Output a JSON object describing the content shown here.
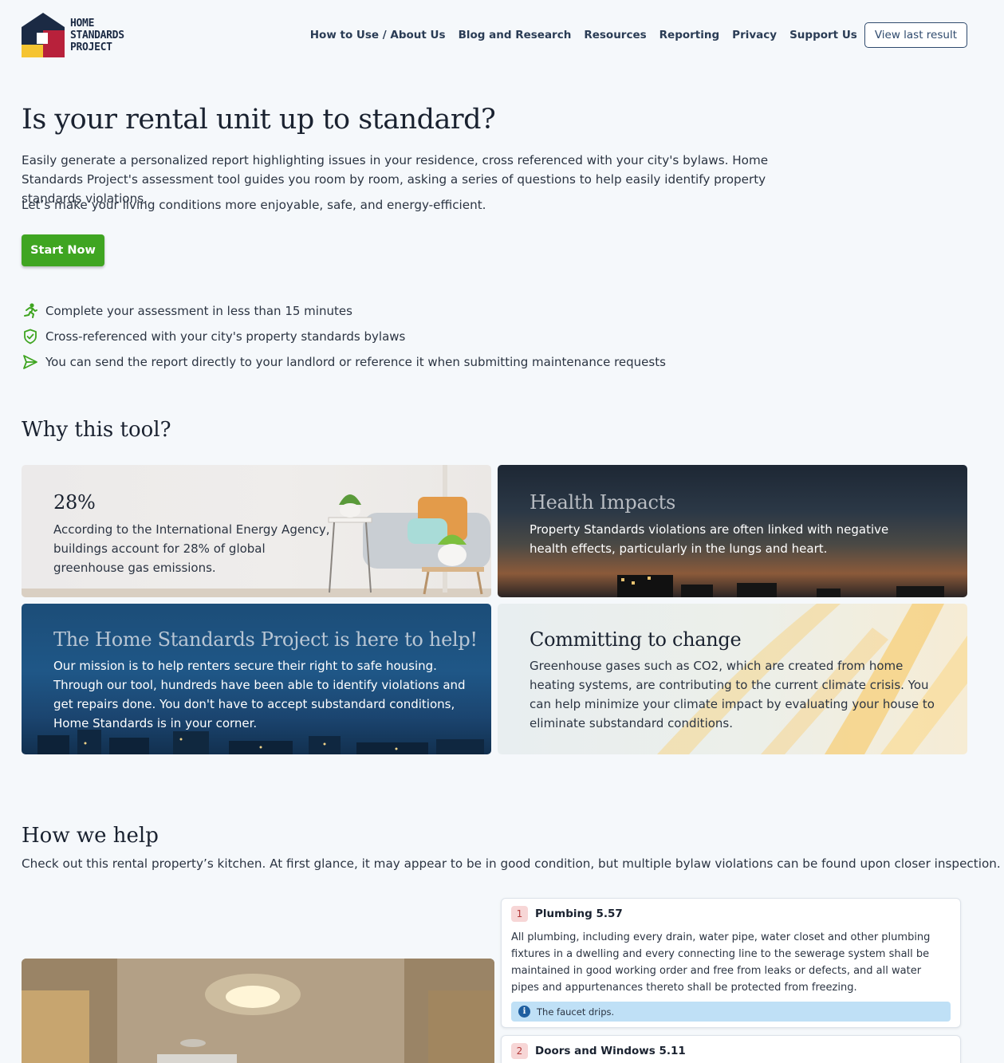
{
  "brand": {
    "logo_lines": [
      "HOME",
      "STANDARDS",
      "PROJECT"
    ],
    "colors": {
      "navy": "#1b2a44",
      "red": "#b8213b",
      "yellow": "#f5c431",
      "green": "#3fa521"
    }
  },
  "nav": {
    "items": [
      "How to Use / About Us",
      "Blog and Research",
      "Resources",
      "Reporting",
      "Privacy",
      "Support Us"
    ],
    "cta": "View last result"
  },
  "hero": {
    "title": "Is your rental unit up to standard?",
    "paragraph1": "Easily generate a personalized report highlighting issues in your residence, cross referenced with your city's bylaws. Home Standards Project's assessment tool guides you room by room, asking a series of questions to help easily identify property standards violations.",
    "paragraph2": "Let’s make your living conditions more enjoyable, safe, and energy-efficient.",
    "start_button": "Start Now",
    "features": [
      {
        "icon": "running-person-icon",
        "text": "Complete your assessment in less than 15 minutes"
      },
      {
        "icon": "shield-check-icon",
        "text": "Cross-referenced with your city's property standards bylaws"
      },
      {
        "icon": "send-icon",
        "text": "You can send the report directly to your landlord or reference it when submitting maintenance requests"
      }
    ]
  },
  "why": {
    "title": "Why this tool?",
    "cards": [
      {
        "title": "28%",
        "text": "According to the International Energy Agency, buildings account for 28% of global greenhouse gas emissions."
      },
      {
        "title": "Health Impacts",
        "text": "Property Standards violations are often linked with negative health effects, particularly in the lungs and heart."
      },
      {
        "title": "The Home Standards Project is here to help!",
        "text": "Our mission is to help renters secure their right to safe housing. Through our tool, hundreds have been able to identify violations and get repairs done. You don't have to accept substandard conditions, Home Standards is in your corner."
      },
      {
        "title": "Committing to change",
        "text": "Greenhouse gases such as CO2, which are created from home heating systems, are contributing to the current climate crisis. You can help minimize your climate impact by evaluating your house to eliminate substandard conditions."
      }
    ]
  },
  "how": {
    "title": "How we help",
    "text": "Check out this rental property’s kitchen. At first glance, it may appear to be in good condition, but multiple bylaw violations can be found upon closer inspection.",
    "violations": [
      {
        "number": "1",
        "title": "Plumbing 5.57",
        "text": "All plumbing, including every drain, water pipe, water closet and other plumbing fixtures in a dwelling and every connecting line to the sewerage system shall be maintained in good working order and free from leaks or defects, and all water pipes and appurtenances thereto shall be protected from freezing.",
        "note": "The faucet drips."
      },
      {
        "number": "2",
        "title": "Doors and Windows 5.11"
      }
    ]
  }
}
